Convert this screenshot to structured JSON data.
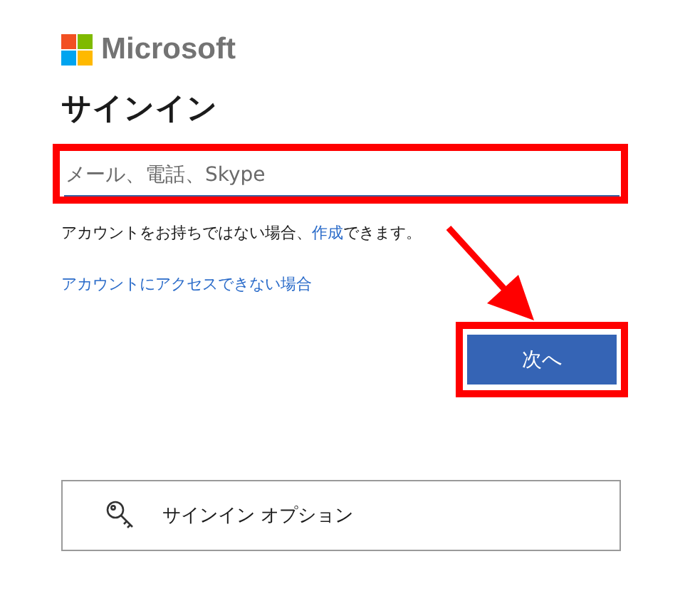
{
  "logo": {
    "text": "Microsoft"
  },
  "heading": "サインイン",
  "email_field": {
    "placeholder": "メール、電話、Skype",
    "highlighted": true
  },
  "no_account": {
    "before": "アカウントをお持ちではない場合、",
    "link": "作成",
    "after": "できます。"
  },
  "cannot_access_link": "アカウントにアクセスできない場合",
  "next_button": {
    "label": "次へ",
    "highlighted": true
  },
  "annotation_arrow": true,
  "options_button": {
    "label": "サインイン オプション"
  }
}
